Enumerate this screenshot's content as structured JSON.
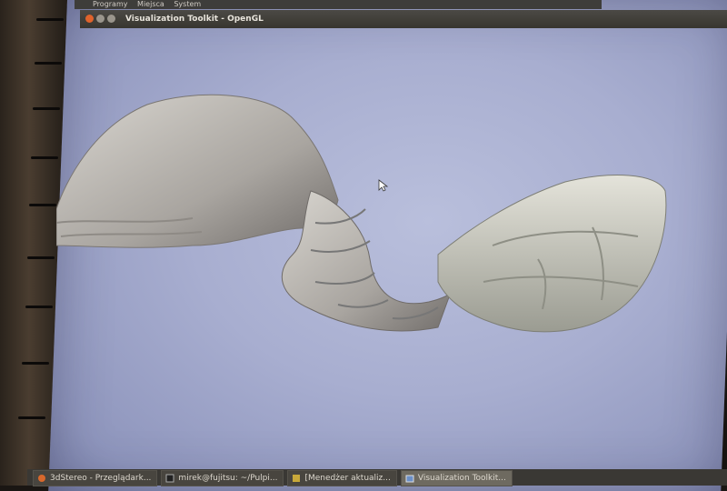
{
  "top_panel": {
    "menu_programs": "Programy",
    "menu_places": "Miejsca",
    "menu_system": "System"
  },
  "window": {
    "title": "Visualization Toolkit - OpenGL"
  },
  "viewport": {
    "content": "3D volume render of anatomical structure",
    "background_color": "#a8aed0",
    "model_color": "#c9c6c0"
  },
  "taskbar": {
    "tasks": [
      {
        "label": "3dStereo - Przeglądark...",
        "icon": "browser-icon"
      },
      {
        "label": "mirek@fujitsu: ~/Pulpi...",
        "icon": "terminal-icon"
      },
      {
        "label": "[Menedżer aktualiz...",
        "icon": "update-manager-icon"
      },
      {
        "label": "Visualization Toolkit...",
        "icon": "window-icon"
      }
    ]
  }
}
